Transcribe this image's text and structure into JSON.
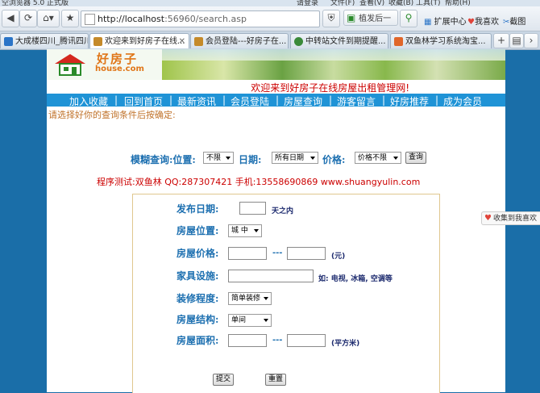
{
  "browser": {
    "title_fragment": "空浏览器 5.0 正式版",
    "login_text": "请登录",
    "menus": [
      "文件(F)",
      "查看(V)",
      "收藏(B)",
      "工具(T)",
      "帮助(H)"
    ],
    "address_host": "http://localhost",
    "address_path": ":56960/search.asp",
    "search_engine": "植发后一",
    "extensions_label": "扩展中心",
    "favorite_label": "我喜欢",
    "screenshot_label": "截图",
    "tabs": [
      {
        "label": "大成楼四川_腾讯四川...",
        "active": false,
        "color": "#2a74c7"
      },
      {
        "label": "欢迎来到好房子在线...",
        "active": true,
        "color": "#c58a2a"
      },
      {
        "label": "会员登陆---好房子在...",
        "active": false,
        "color": "#c58a2a"
      },
      {
        "label": "中转站文件到期提醒...",
        "active": false,
        "color": "#3a8a3a"
      },
      {
        "label": "双鱼林学习系统淘宝...",
        "active": false,
        "color": "#e0662a"
      }
    ]
  },
  "site": {
    "logo_cn": "好房子",
    "logo_en": "house.com",
    "welcome": "欢迎来到好房子在线房屋出租管理网!",
    "nav": [
      "加入收藏",
      "回到首页",
      "最新资讯",
      "会员登陆",
      "房屋查询",
      "游客留言",
      "好房推荐",
      "成为会员"
    ],
    "instruction": "请选择好你的查询条件后按确定:"
  },
  "fuzzy_search": {
    "title": "模糊查询:位置:",
    "location_value": "不限",
    "date_label": "日期:",
    "date_value": "所有日期",
    "price_label": "价格:",
    "price_value": "价格不限",
    "button": "查询"
  },
  "credit": "程序测试:双鱼林 QQ:287307421 手机:13558690869 www.shuangyulin.com",
  "form": {
    "publish_date_label": "发布日期:",
    "publish_date_hint": "天之内",
    "location_label": "房屋位置:",
    "location_value": "城 中",
    "price_label": "房屋价格:",
    "price_dash": "---",
    "price_unit": "(元)",
    "furniture_label": "家具设施:",
    "furniture_hint": "如: 电视, 冰箱, 空调等",
    "decoration_label": "装修程度:",
    "decoration_value": "简单装修",
    "structure_label": "房屋结构:",
    "structure_value": "单间",
    "area_label": "房屋面积:",
    "area_dash": "---",
    "area_unit": "(平方米)",
    "submit": "提交",
    "reset": "重置"
  },
  "side_tab": "收集到我喜欢"
}
